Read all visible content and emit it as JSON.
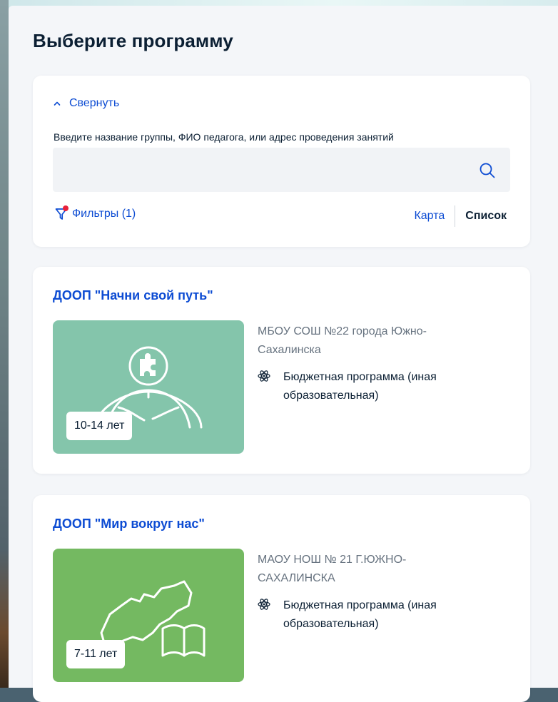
{
  "page": {
    "title": "Выберите программу"
  },
  "search": {
    "collapse_label": "Свернуть",
    "label": "Введите название группы, ФИО педагога, или адрес проведения занятий",
    "value": "",
    "placeholder": "",
    "filters_label": "Фильтры (1)",
    "view_map": "Карта",
    "view_list": "Список",
    "active_view": "Список",
    "filter_badge_color": "#e8203a"
  },
  "programs": [
    {
      "title": "ДООП \"Начни свой путь\"",
      "organization": "МБОУ СОШ №22 города Южно-Сахалинска",
      "funding": "Бюджетная программа (иная образовательная)",
      "age": "10-14 лет",
      "image_color": "#84c5ab",
      "image_icon": "person-puzzle-icon"
    },
    {
      "title": "ДООП \"Мир вокруг нас\"",
      "organization": "МАОУ НОШ № 21 Г.ЮЖНО-САХАЛИНСКА",
      "funding": "Бюджетная программа (иная образовательная)",
      "age": "7-11 лет",
      "image_color": "#74b961",
      "image_icon": "map-book-icon"
    }
  ],
  "colors": {
    "link": "#0d4cd3",
    "text": "#0b1f33",
    "muted": "#66727f",
    "background": "#f4f6f9"
  }
}
